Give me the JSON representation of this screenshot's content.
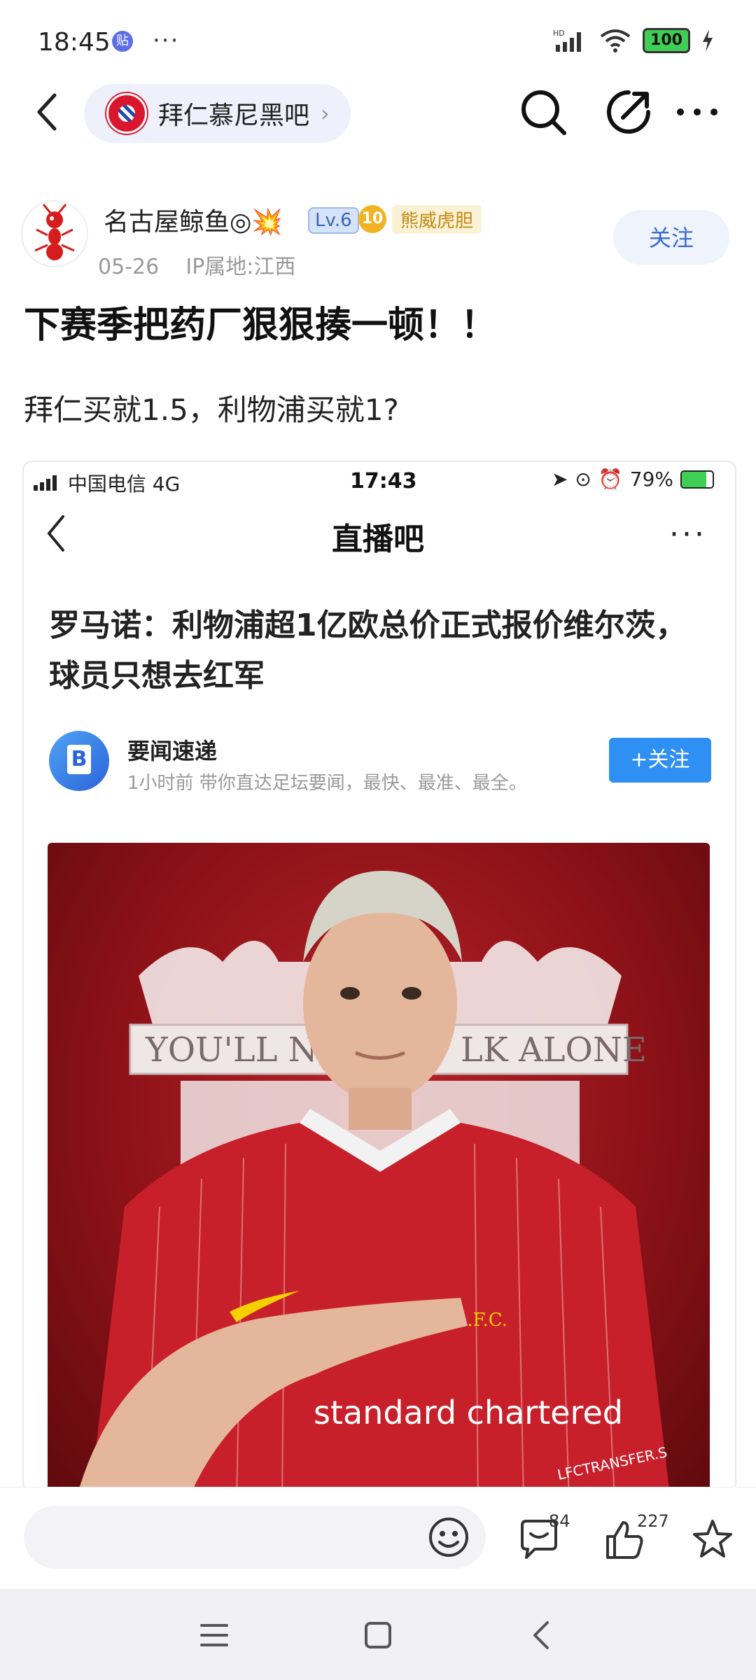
{
  "status_bar": {
    "time": "18:45",
    "app_badge": "贴",
    "more_dots": "···",
    "network": "HD",
    "battery": "100"
  },
  "nav": {
    "forum_name": "拜仁慕尼黑吧",
    "forum_chevron": "›"
  },
  "author": {
    "name": "名古屋鲸鱼◎💥",
    "level": "Lv.6",
    "medal_number": "10",
    "medal_title": "熊威虎胆",
    "date": "05-26",
    "ip_location": "IP属地:江西",
    "follow_label": "关注"
  },
  "post": {
    "title": "下赛季把药厂狠狠揍一顿！！",
    "body": "拜仁买就1.5，利物浦买就1?"
  },
  "embedded": {
    "carrier": "中国电信  4G",
    "time": "17:43",
    "battery_text": "79%",
    "app_title": "直播吧",
    "more": "···",
    "headline": "罗马诺：利物浦超1亿欧总价正式报价维尔茨，球员只想去红军",
    "source_name": "要闻速递",
    "source_meta": "1小时前   带你直达足坛要闻，最快、最准、最全。",
    "source_follow": "+关注",
    "source_avatar_letter": "B",
    "photo_text_top": "YOU'LL NE",
    "photo_text_top2": "LK ALONE",
    "photo_sponsor": "standard chartered",
    "photo_watermark": "LFCTRANSFER.S",
    "photo_crest": "L.F.C."
  },
  "bottom_bar": {
    "comment_placeholder": "",
    "comment_count": "84",
    "like_count": "227"
  },
  "colors": {
    "accent_blue": "#3a6bd1",
    "follow_blue": "#2e90f2",
    "battery_green": "#3fcf54"
  }
}
